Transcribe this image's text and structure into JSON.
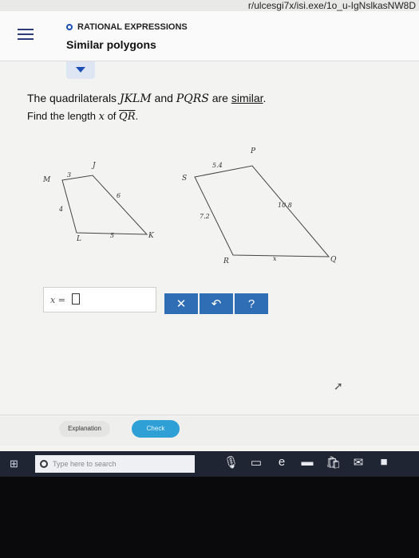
{
  "url": "r/ulcesgi7x/isi.exe/1o_u-IgNslkasNW8D",
  "header": {
    "topic": "RATIONAL EXPRESSIONS",
    "lesson": "Similar polygons"
  },
  "question": {
    "p1_a": "The quadrilaterals ",
    "quad1": "JKLM",
    "p1_b": " and ",
    "quad2": "PQRS",
    "p1_c": " are ",
    "similar": "similar",
    "p1_d": ".",
    "p2_a": "Find the length ",
    "var": "x",
    "p2_b": " of ",
    "seg": "QR",
    "p2_c": "."
  },
  "figure": {
    "small": {
      "vertices": {
        "J": "J",
        "K": "K",
        "L": "L",
        "M": "M"
      },
      "sides": {
        "MJ": "3",
        "JK": "6",
        "ML": "4",
        "LK": "5"
      }
    },
    "large": {
      "vertices": {
        "P": "P",
        "Q": "Q",
        "R": "R",
        "S": "S"
      },
      "sides": {
        "SP": "5.4",
        "PQ": "10.8",
        "SR": "7.2",
        "RQ": "x"
      }
    }
  },
  "answer": {
    "label": "x ="
  },
  "buttons": {
    "clear": "✕",
    "undo": "↶",
    "help": "?"
  },
  "bottom": {
    "explanation": "Explanation",
    "check": "Check"
  },
  "taskbar": {
    "search_placeholder": "Type here to search"
  }
}
